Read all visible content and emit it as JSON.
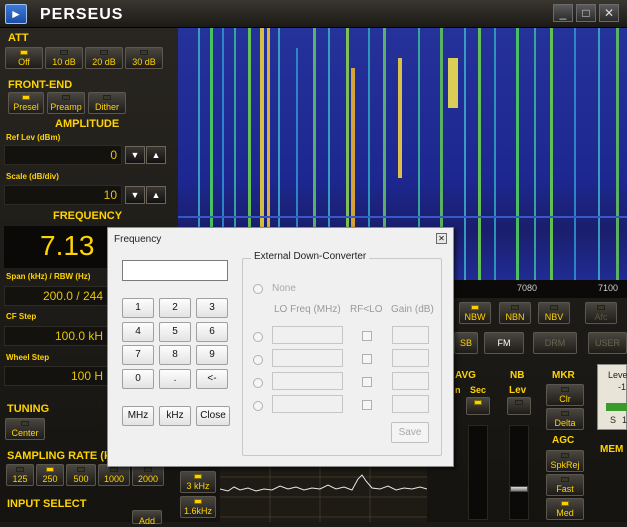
{
  "app": {
    "title": "PERSEUS",
    "logo_glyph": "►",
    "min_glyph": "_",
    "max_glyph": "□",
    "close_glyph": "✕"
  },
  "att": {
    "label": "ATT",
    "buttons": [
      "Off",
      "10 dB",
      "20 dB",
      "30 dB"
    ]
  },
  "front_end": {
    "label": "FRONT-END",
    "buttons": [
      "Presel",
      "Preamp",
      "Dither"
    ]
  },
  "amplitude": {
    "label": "AMPLITUDE",
    "ref_label": "Ref Lev (dBm)",
    "ref_value": "0",
    "scale_label": "Scale (dB/div)",
    "scale_value": "10"
  },
  "frequency": {
    "label": "FREQUENCY",
    "value": "7.13",
    "span_label": "Span (kHz) / RBW (Hz)",
    "span_value": "200.0 / 244",
    "cf_label": "CF Step",
    "cf_value": "100.0 kH",
    "wheel_label": "Wheel Step",
    "wheel_value": "100 H"
  },
  "tuning": {
    "label": "TUNING",
    "center": "Center"
  },
  "sampling": {
    "label": "SAMPLING RATE (k",
    "rates": [
      "125",
      "250",
      "500",
      "1000",
      "2000"
    ]
  },
  "input_select": {
    "label": "INPUT SELECT",
    "add": "Add"
  },
  "scale_ticks": [
    "7080",
    "7100"
  ],
  "arrows": {
    "down": "▼",
    "up": "▲"
  },
  "filters": {
    "bw3": "3 kHz",
    "bw16": "1.6kHz"
  },
  "noise": {
    "nbw": "NBW",
    "nbn": "NBN",
    "nbv": "NBV",
    "afc": "Afc"
  },
  "modes": {
    "usb": "SB",
    "fm": "FM",
    "drm": "DRM",
    "user": "USER"
  },
  "avg": {
    "label": "AVG",
    "sec": "Sec",
    "m": "n"
  },
  "nb": {
    "label": "NB",
    "lev": "Lev"
  },
  "mkr": {
    "label": "MKR",
    "clr": "Clr",
    "delta": "Delta"
  },
  "agc": {
    "label": "AGC",
    "spkrej": "SpkRej",
    "fast": "Fast",
    "med": "Med"
  },
  "level": {
    "label": "Leve",
    "s": "S",
    "one": "1",
    "dash": "-1"
  },
  "mem": {
    "label": "MEM"
  },
  "dialog": {
    "title": "Frequency",
    "close": "✕",
    "keys": [
      "1",
      "2",
      "3",
      "4",
      "5",
      "6",
      "7",
      "8",
      "9",
      "0",
      ".",
      "<-"
    ],
    "units": [
      "MHz",
      "kHz",
      "Close"
    ],
    "group_title": "External Down-Converter",
    "none": "None",
    "col_lo": "LO Freq (MHz)",
    "col_rflo": "RF<LO",
    "col_gain": "Gain (dB)",
    "save": "Save"
  },
  "colors": {
    "accent": "#ffd400",
    "waterfall_bg": "#1d2790",
    "dialog_bg": "#f0f0f0"
  }
}
